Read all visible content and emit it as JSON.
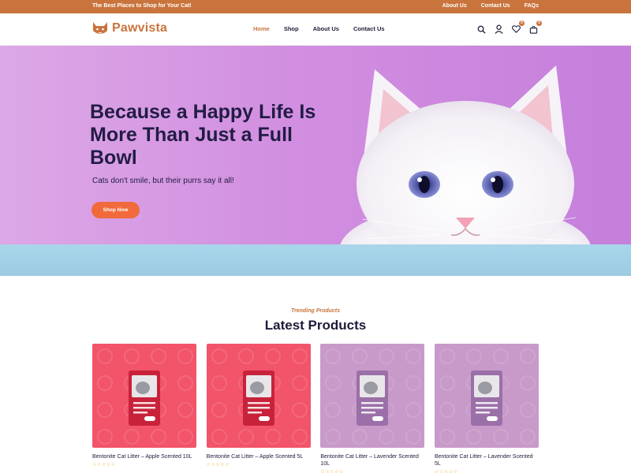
{
  "topbar": {
    "tagline": "The Best Places to Shop for Your Cat!",
    "links": [
      "About Us",
      "Contact Us",
      "FAQs"
    ]
  },
  "header": {
    "logo_text": "Pawvista",
    "nav": [
      {
        "label": "Home",
        "active": true
      },
      {
        "label": "Shop",
        "active": false
      },
      {
        "label": "About Us",
        "active": false
      },
      {
        "label": "Contact Us",
        "active": false
      }
    ],
    "icons": [
      "search-icon",
      "user-icon",
      "heart-icon",
      "cart-icon"
    ],
    "wishlist_count": "0",
    "cart_count": "0"
  },
  "hero": {
    "title": "Because a Happy Life Is More Than Just a Full Bowl",
    "subtitle": "Cats don't smile, but their purrs say it all!",
    "cta_label": "Shop Now"
  },
  "products_section": {
    "kicker": "Trending Products",
    "title": "Latest Products",
    "items": [
      {
        "name": "Bentonite Cat Litter – Apple Scented 10L",
        "bg": "#f2546a",
        "pack": "#c8223a"
      },
      {
        "name": "Bentonite Cat Litter – Apple Scented 5L",
        "bg": "#f2546a",
        "pack": "#c8223a"
      },
      {
        "name": "Bentonite Cat Litter – Lavender Scented 10L",
        "bg": "#c79ac9",
        "pack": "#9b6fa8"
      },
      {
        "name": "Bentonite Cat Litter – Lavender Scented 5L",
        "bg": "#c79ac9",
        "pack": "#9b6fa8"
      }
    ],
    "rating_stars": "☆☆☆☆☆"
  },
  "colors": {
    "brand": "#c9743c",
    "cta": "#f16a3c",
    "text_dark": "#1e1b3a",
    "hero_bg": "#d28fe0"
  }
}
